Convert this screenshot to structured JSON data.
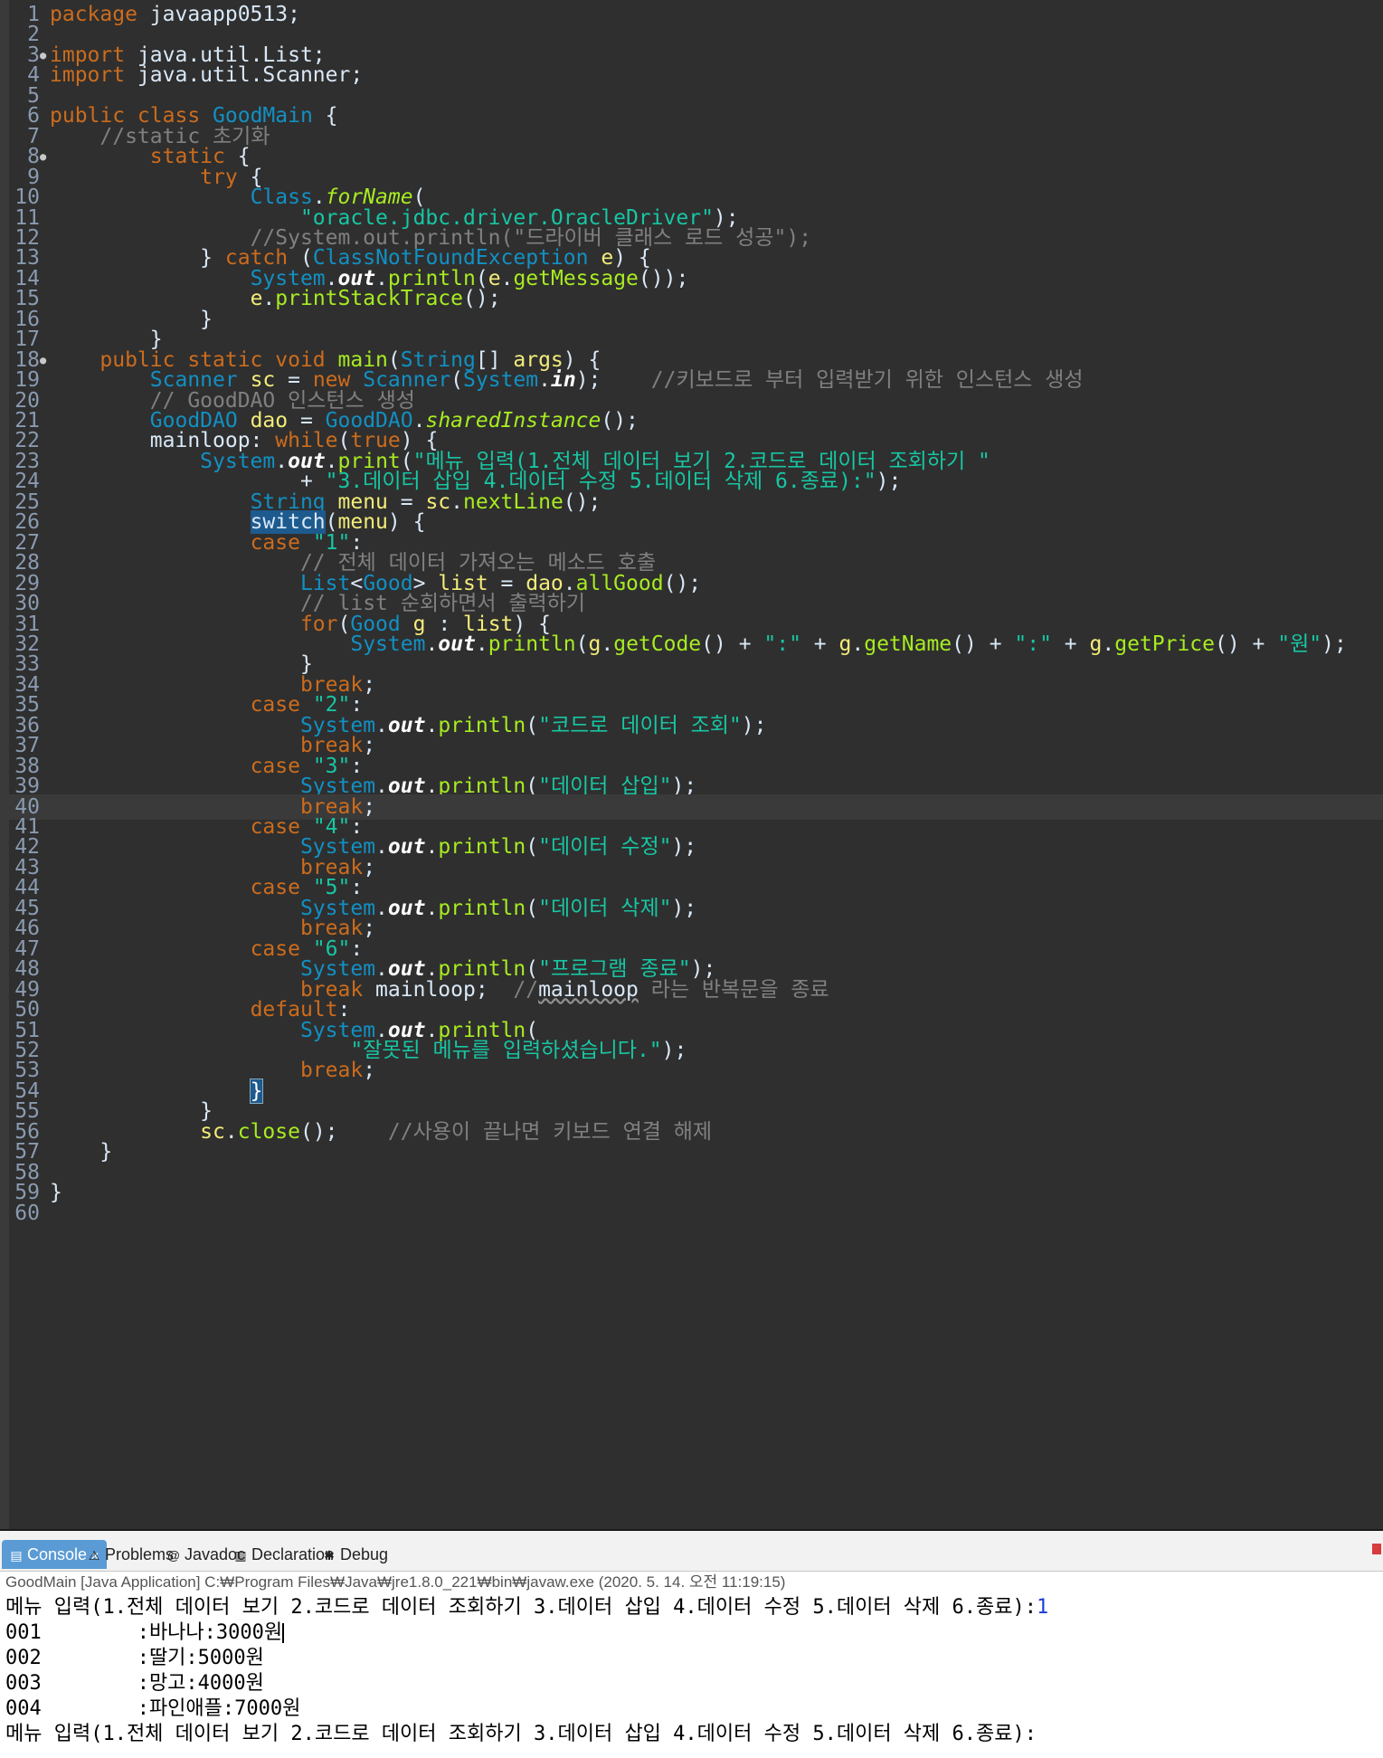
{
  "editor": {
    "lines": [
      [
        [
          "kw",
          "package"
        ],
        [
          "pl",
          " javaapp0513;"
        ]
      ],
      [],
      [
        [
          "kw",
          "import"
        ],
        [
          "pl",
          " java.util.List;"
        ]
      ],
      [
        [
          "kw",
          "import"
        ],
        [
          "pl",
          " java.util.Scanner;"
        ]
      ],
      [],
      [
        [
          "kw",
          "public class"
        ],
        [
          "pl",
          " "
        ],
        [
          "cls",
          "GoodMain"
        ],
        [
          "pl",
          " {"
        ]
      ],
      [
        [
          "pl",
          "    "
        ],
        [
          "cm",
          "//static 초기화"
        ]
      ],
      [
        [
          "pl",
          "        "
        ],
        [
          "kw",
          "static"
        ],
        [
          "pl",
          " {"
        ]
      ],
      [
        [
          "pl",
          "            "
        ],
        [
          "kw",
          "try"
        ],
        [
          "pl",
          " {"
        ]
      ],
      [
        [
          "pl",
          "                "
        ],
        [
          "type",
          "Class"
        ],
        [
          "pl",
          "."
        ],
        [
          "st",
          "forName"
        ],
        [
          "pl",
          "("
        ]
      ],
      [
        [
          "pl",
          "                    "
        ],
        [
          "str",
          "\"oracle.jdbc.driver.OracleDriver\""
        ],
        [
          "pl",
          ");"
        ]
      ],
      [
        [
          "pl",
          "                "
        ],
        [
          "cm",
          "//System.out.println(\"드라이버 클래스 로드 성공\");"
        ]
      ],
      [
        [
          "pl",
          "            } "
        ],
        [
          "kw",
          "catch"
        ],
        [
          "pl",
          " ("
        ],
        [
          "type",
          "ClassNotFoundException"
        ],
        [
          "pl",
          " "
        ],
        [
          "var",
          "e"
        ],
        [
          "pl",
          ") {"
        ]
      ],
      [
        [
          "pl",
          "                "
        ],
        [
          "type",
          "System"
        ],
        [
          "pl",
          "."
        ],
        [
          "sf",
          "out"
        ],
        [
          "pl",
          "."
        ],
        [
          "fn",
          "println"
        ],
        [
          "pl",
          "("
        ],
        [
          "var",
          "e"
        ],
        [
          "pl",
          "."
        ],
        [
          "fn",
          "getMessage"
        ],
        [
          "pl",
          "());"
        ]
      ],
      [
        [
          "pl",
          "                "
        ],
        [
          "var",
          "e"
        ],
        [
          "pl",
          "."
        ],
        [
          "fn",
          "printStackTrace"
        ],
        [
          "pl",
          "();"
        ]
      ],
      [
        [
          "pl",
          "            }"
        ]
      ],
      [
        [
          "pl",
          "        }"
        ]
      ],
      [
        [
          "pl",
          "    "
        ],
        [
          "kw",
          "public static void"
        ],
        [
          "pl",
          " "
        ],
        [
          "fn",
          "main"
        ],
        [
          "pl",
          "("
        ],
        [
          "type",
          "String"
        ],
        [
          "pl",
          "[] "
        ],
        [
          "var",
          "args"
        ],
        [
          "pl",
          ") {"
        ]
      ],
      [
        [
          "pl",
          "        "
        ],
        [
          "type",
          "Scanner"
        ],
        [
          "pl",
          " "
        ],
        [
          "var",
          "sc"
        ],
        [
          "pl",
          " = "
        ],
        [
          "kw",
          "new"
        ],
        [
          "pl",
          " "
        ],
        [
          "type",
          "Scanner"
        ],
        [
          "pl",
          "("
        ],
        [
          "type",
          "System"
        ],
        [
          "pl",
          "."
        ],
        [
          "sf",
          "in"
        ],
        [
          "pl",
          ");    "
        ],
        [
          "cm",
          "//키보드로 부터 입력받기 위한 인스턴스 생성"
        ]
      ],
      [
        [
          "pl",
          "        "
        ],
        [
          "cm",
          "// GoodDAO 인스턴스 생성"
        ]
      ],
      [
        [
          "pl",
          "        "
        ],
        [
          "type",
          "GoodDAO"
        ],
        [
          "pl",
          " "
        ],
        [
          "var",
          "dao"
        ],
        [
          "pl",
          " = "
        ],
        [
          "type",
          "GoodDAO"
        ],
        [
          "pl",
          "."
        ],
        [
          "st",
          "sharedInstance"
        ],
        [
          "pl",
          "();"
        ]
      ],
      [
        [
          "pl",
          "        mainloop: "
        ],
        [
          "kw",
          "while"
        ],
        [
          "pl",
          "("
        ],
        [
          "kw",
          "true"
        ],
        [
          "pl",
          ") {"
        ]
      ],
      [
        [
          "pl",
          "            "
        ],
        [
          "type",
          "System"
        ],
        [
          "pl",
          "."
        ],
        [
          "sf",
          "out"
        ],
        [
          "pl",
          "."
        ],
        [
          "fn",
          "print"
        ],
        [
          "pl",
          "("
        ],
        [
          "str",
          "\"메뉴 입력(1.전체 데이터 보기 2.코드로 데이터 조회하기 \""
        ]
      ],
      [
        [
          "pl",
          "                    + "
        ],
        [
          "str",
          "\"3.데이터 삽입 4.데이터 수정 5.데이터 삭제 6.종료):\""
        ],
        [
          "pl",
          ");"
        ]
      ],
      [
        [
          "pl",
          "                "
        ],
        [
          "type",
          "String"
        ],
        [
          "pl",
          " "
        ],
        [
          "var",
          "menu"
        ],
        [
          "pl",
          " = "
        ],
        [
          "var",
          "sc"
        ],
        [
          "pl",
          "."
        ],
        [
          "fn",
          "nextLine"
        ],
        [
          "pl",
          "();"
        ]
      ],
      [
        [
          "pl",
          "                "
        ],
        [
          "sel",
          "switch"
        ],
        [
          "pl",
          "("
        ],
        [
          "var",
          "menu"
        ],
        [
          "pl",
          ") {"
        ]
      ],
      [
        [
          "pl",
          "                "
        ],
        [
          "kw",
          "case"
        ],
        [
          "pl",
          " "
        ],
        [
          "str",
          "\"1\""
        ],
        [
          "pl",
          ":"
        ]
      ],
      [
        [
          "pl",
          "                    "
        ],
        [
          "cm",
          "// 전체 데이터 가져오는 메소드 호출"
        ]
      ],
      [
        [
          "pl",
          "                    "
        ],
        [
          "type",
          "List"
        ],
        [
          "pl",
          "<"
        ],
        [
          "cls",
          "Good"
        ],
        [
          "pl",
          "> "
        ],
        [
          "var",
          "list"
        ],
        [
          "pl",
          " = "
        ],
        [
          "var",
          "dao"
        ],
        [
          "pl",
          "."
        ],
        [
          "fn",
          "allGood"
        ],
        [
          "pl",
          "();"
        ]
      ],
      [
        [
          "pl",
          "                    "
        ],
        [
          "cm",
          "// list 순회하면서 출력하기"
        ]
      ],
      [
        [
          "pl",
          "                    "
        ],
        [
          "kw",
          "for"
        ],
        [
          "pl",
          "("
        ],
        [
          "cls",
          "Good"
        ],
        [
          "pl",
          " "
        ],
        [
          "var",
          "g"
        ],
        [
          "pl",
          " : "
        ],
        [
          "var",
          "list"
        ],
        [
          "pl",
          ") {"
        ]
      ],
      [
        [
          "pl",
          "                        "
        ],
        [
          "type",
          "System"
        ],
        [
          "pl",
          "."
        ],
        [
          "sf",
          "out"
        ],
        [
          "pl",
          "."
        ],
        [
          "fn",
          "println"
        ],
        [
          "pl",
          "("
        ],
        [
          "var",
          "g"
        ],
        [
          "pl",
          "."
        ],
        [
          "fn",
          "getCode"
        ],
        [
          "pl",
          "() + "
        ],
        [
          "str",
          "\":\""
        ],
        [
          "pl",
          " + "
        ],
        [
          "var",
          "g"
        ],
        [
          "pl",
          "."
        ],
        [
          "fn",
          "getName"
        ],
        [
          "pl",
          "() + "
        ],
        [
          "str",
          "\":\""
        ],
        [
          "pl",
          " + "
        ],
        [
          "var",
          "g"
        ],
        [
          "pl",
          "."
        ],
        [
          "fn",
          "getPrice"
        ],
        [
          "pl",
          "() + "
        ],
        [
          "str",
          "\"원\""
        ],
        [
          "pl",
          ");"
        ]
      ],
      [
        [
          "pl",
          "                    }"
        ]
      ],
      [
        [
          "pl",
          "                    "
        ],
        [
          "kw",
          "break"
        ],
        [
          "pl",
          ";"
        ]
      ],
      [
        [
          "pl",
          "                "
        ],
        [
          "kw",
          "case"
        ],
        [
          "pl",
          " "
        ],
        [
          "str",
          "\"2\""
        ],
        [
          "pl",
          ":"
        ]
      ],
      [
        [
          "pl",
          "                    "
        ],
        [
          "type",
          "System"
        ],
        [
          "pl",
          "."
        ],
        [
          "sf",
          "out"
        ],
        [
          "pl",
          "."
        ],
        [
          "fn",
          "println"
        ],
        [
          "pl",
          "("
        ],
        [
          "str",
          "\"코드로 데이터 조회\""
        ],
        [
          "pl",
          ");"
        ]
      ],
      [
        [
          "pl",
          "                    "
        ],
        [
          "kw",
          "break"
        ],
        [
          "pl",
          ";"
        ]
      ],
      [
        [
          "pl",
          "                "
        ],
        [
          "kw",
          "case"
        ],
        [
          "pl",
          " "
        ],
        [
          "str",
          "\"3\""
        ],
        [
          "pl",
          ":"
        ]
      ],
      [
        [
          "pl",
          "                    "
        ],
        [
          "type",
          "System"
        ],
        [
          "pl",
          "."
        ],
        [
          "sf",
          "out"
        ],
        [
          "pl",
          "."
        ],
        [
          "fn",
          "println"
        ],
        [
          "pl",
          "("
        ],
        [
          "str",
          "\"데이터 삽입\""
        ],
        [
          "pl",
          ");"
        ]
      ],
      [
        [
          "pl",
          "                    "
        ],
        [
          "kw",
          "break"
        ],
        [
          "pl",
          ";"
        ]
      ],
      [
        [
          "pl",
          "                "
        ],
        [
          "kw",
          "case"
        ],
        [
          "pl",
          " "
        ],
        [
          "str",
          "\"4\""
        ],
        [
          "pl",
          ":"
        ]
      ],
      [
        [
          "pl",
          "                    "
        ],
        [
          "type",
          "System"
        ],
        [
          "pl",
          "."
        ],
        [
          "sf",
          "out"
        ],
        [
          "pl",
          "."
        ],
        [
          "fn",
          "println"
        ],
        [
          "pl",
          "("
        ],
        [
          "str",
          "\"데이터 수정\""
        ],
        [
          "pl",
          ");"
        ]
      ],
      [
        [
          "pl",
          "                    "
        ],
        [
          "kw",
          "break"
        ],
        [
          "pl",
          ";"
        ]
      ],
      [
        [
          "pl",
          "                "
        ],
        [
          "kw",
          "case"
        ],
        [
          "pl",
          " "
        ],
        [
          "str",
          "\"5\""
        ],
        [
          "pl",
          ":"
        ]
      ],
      [
        [
          "pl",
          "                    "
        ],
        [
          "type",
          "System"
        ],
        [
          "pl",
          "."
        ],
        [
          "sf",
          "out"
        ],
        [
          "pl",
          "."
        ],
        [
          "fn",
          "println"
        ],
        [
          "pl",
          "("
        ],
        [
          "str",
          "\"데이터 삭제\""
        ],
        [
          "pl",
          ");"
        ]
      ],
      [
        [
          "pl",
          "                    "
        ],
        [
          "kw",
          "break"
        ],
        [
          "pl",
          ";"
        ]
      ],
      [
        [
          "pl",
          "                "
        ],
        [
          "kw",
          "case"
        ],
        [
          "pl",
          " "
        ],
        [
          "str",
          "\"6\""
        ],
        [
          "pl",
          ":"
        ]
      ],
      [
        [
          "pl",
          "                    "
        ],
        [
          "type",
          "System"
        ],
        [
          "pl",
          "."
        ],
        [
          "sf",
          "out"
        ],
        [
          "pl",
          "."
        ],
        [
          "fn",
          "println"
        ],
        [
          "pl",
          "("
        ],
        [
          "str",
          "\"프로그램 종료\""
        ],
        [
          "pl",
          ");"
        ]
      ],
      [
        [
          "pl",
          "                    "
        ],
        [
          "kw",
          "break"
        ],
        [
          "pl",
          " mainloop;  "
        ],
        [
          "cm",
          "//"
        ],
        [
          "squig",
          "mainloop"
        ],
        [
          "cm",
          " 라는 반복문을 종료"
        ]
      ],
      [
        [
          "pl",
          "                "
        ],
        [
          "kw",
          "default"
        ],
        [
          "pl",
          ":"
        ]
      ],
      [
        [
          "pl",
          "                    "
        ],
        [
          "type",
          "System"
        ],
        [
          "pl",
          "."
        ],
        [
          "sf",
          "out"
        ],
        [
          "pl",
          "."
        ],
        [
          "fn",
          "println"
        ],
        [
          "pl",
          "("
        ]
      ],
      [
        [
          "pl",
          "                        "
        ],
        [
          "str",
          "\"잘못된 메뉴를 입력하셨습니다.\""
        ],
        [
          "pl",
          ");"
        ]
      ],
      [
        [
          "pl",
          "                    "
        ],
        [
          "kw",
          "break"
        ],
        [
          "pl",
          ";"
        ]
      ],
      [
        [
          "pl",
          "                "
        ],
        [
          "brk",
          "}"
        ]
      ],
      [
        [
          "pl",
          "            }"
        ]
      ],
      [
        [
          "pl",
          "            "
        ],
        [
          "var",
          "sc"
        ],
        [
          "pl",
          "."
        ],
        [
          "fn",
          "close"
        ],
        [
          "pl",
          "();    "
        ],
        [
          "cm",
          "//사용이 끝나면 키보드 연결 해제"
        ]
      ],
      [
        [
          "pl",
          "    }"
        ]
      ],
      [],
      [
        [
          "pl",
          "}"
        ]
      ],
      []
    ],
    "fold_markers": {
      "3": "●",
      "8": "●",
      "18": "●"
    },
    "current_line": 40
  },
  "console": {
    "tabs": [
      {
        "label": "Console",
        "icon": "console-icon",
        "glyph": "▤",
        "active": true,
        "close": "✕"
      },
      {
        "label": "Problems",
        "icon": "problems-icon",
        "glyph": "⚠",
        "active": false
      },
      {
        "label": "Javadoc",
        "icon": "javadoc-icon",
        "glyph": "@",
        "active": false
      },
      {
        "label": "Declaration",
        "icon": "declaration-icon",
        "glyph": "▥",
        "active": false
      },
      {
        "label": "Debug",
        "icon": "debug-icon",
        "glyph": "✱",
        "active": false
      }
    ],
    "info": "GoodMain [Java Application] C:₩Program Files₩Java₩jre1.8.0_221₩bin₩javaw.exe (2020. 5. 14. 오전 11:19:15)",
    "output": [
      {
        "text": "메뉴 입력(1.전체 데이터 보기 2.코드로 데이터 조회하기 3.데이터 삽입 4.데이터 수정 5.데이터 삭제 6.종료):",
        "input": "1"
      },
      {
        "text": "001        :바나나:3000원",
        "caret": true
      },
      {
        "text": "002        :딸기:5000원"
      },
      {
        "text": "003        :망고:4000원"
      },
      {
        "text": "004        :파인애플:7000원"
      },
      {
        "text": "메뉴 입력(1.전체 데이터 보기 2.코드로 데이터 조회하기 3.데이터 삽입 4.데이터 수정 5.데이터 삭제 6.종료):"
      }
    ]
  },
  "colors": {
    "editor_bg": "#2f2f2f",
    "keyword": "#cc6c1d",
    "type": "#1290c3",
    "method": "#a7ec21",
    "string": "#17c6a3",
    "comment": "#808080",
    "variable": "#f3ec79",
    "console_tab_active": "#5b9bd5",
    "console_input": "#1a3cd6"
  }
}
